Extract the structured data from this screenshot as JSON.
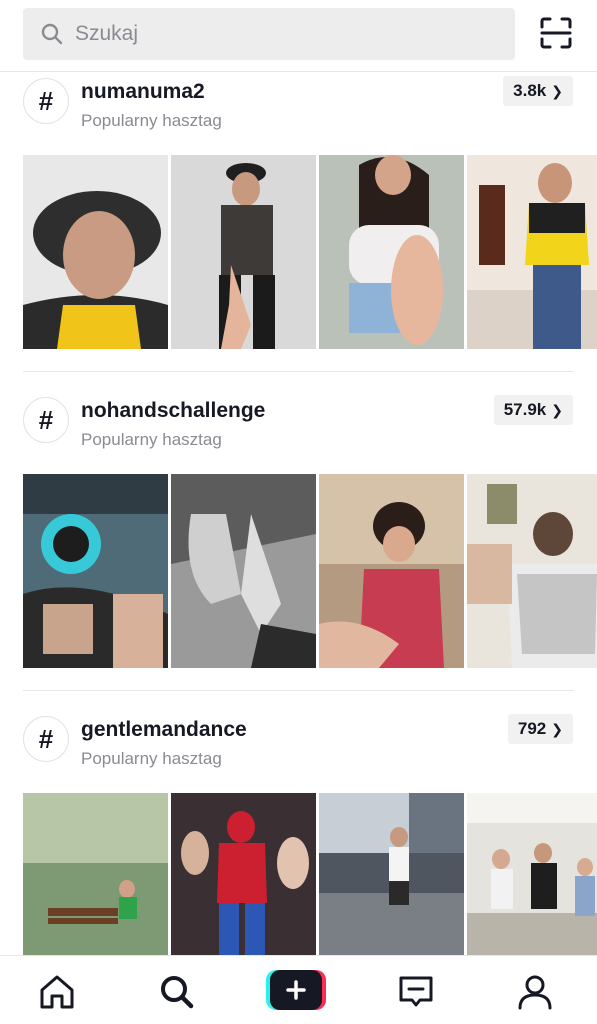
{
  "search": {
    "placeholder": "Szukaj"
  },
  "sections": [
    {
      "tag": "numanuma2",
      "subtitle": "Popularny hasztag",
      "count": "3.8k"
    },
    {
      "tag": "nohandschallenge",
      "subtitle": "Popularny hasztag",
      "count": "57.9k"
    },
    {
      "tag": "gentlemandance",
      "subtitle": "Popularny hasztag",
      "count": "792"
    }
  ],
  "icons": {
    "hash": "#",
    "search": "search-icon",
    "scan": "scan-icon",
    "chevron": "chevron-right-icon",
    "nav": [
      "home-icon",
      "discover-icon",
      "create-icon",
      "inbox-icon",
      "profile-icon"
    ]
  },
  "colors": {
    "create_left": "#25f4ee",
    "create_right": "#fe2c55",
    "create_center": "#161823"
  }
}
